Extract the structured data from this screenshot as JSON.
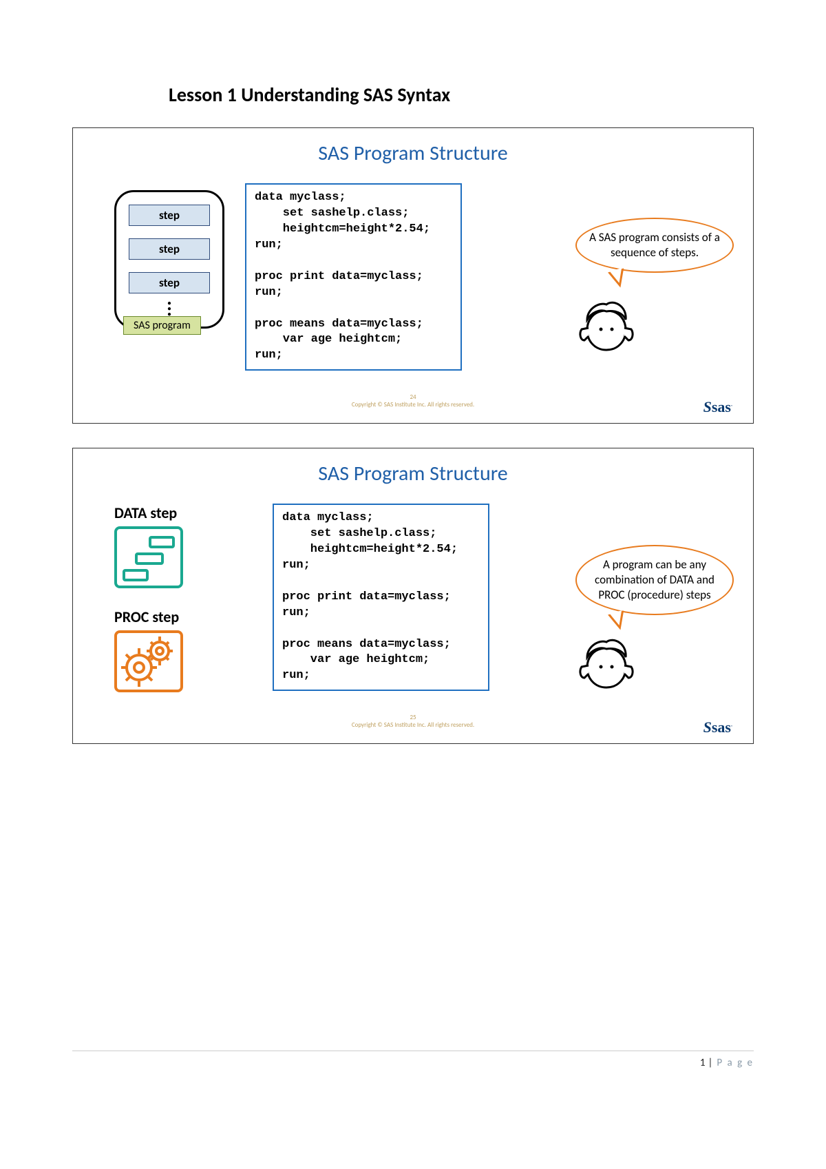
{
  "lessonTitle": "Lesson 1 Understanding SAS Syntax",
  "slide1": {
    "title": "SAS Program Structure",
    "steps": [
      "step",
      "step",
      "step"
    ],
    "programLabel": "SAS program",
    "code": "data myclass;\n    set sashelp.class;\n    heightcm=height*2.54;\nrun;\n\nproc print data=myclass;\nrun;\n\nproc means data=myclass;\n    var age heightcm;\nrun;",
    "bubble": "A SAS program consists of a sequence of steps.",
    "pageNum": "24",
    "copyright": "Copyright © SAS Institute Inc. All rights reserved.",
    "logo": "Ssas"
  },
  "slide2": {
    "title": "SAS Program Structure",
    "dataLabel": "DATA step",
    "procLabel": "PROC step",
    "code": "data myclass;\n    set sashelp.class;\n    heightcm=height*2.54;\nrun;\n\nproc print data=myclass;\nrun;\n\nproc means data=myclass;\n    var age heightcm;\nrun;",
    "bubble": "A program can be any combination of DATA and PROC (procedure) steps",
    "pageNum": "25",
    "copyright": "Copyright © SAS Institute Inc. All rights reserved.",
    "logo": "Ssas"
  },
  "footer": {
    "page": "1",
    "label": "P a g e"
  }
}
